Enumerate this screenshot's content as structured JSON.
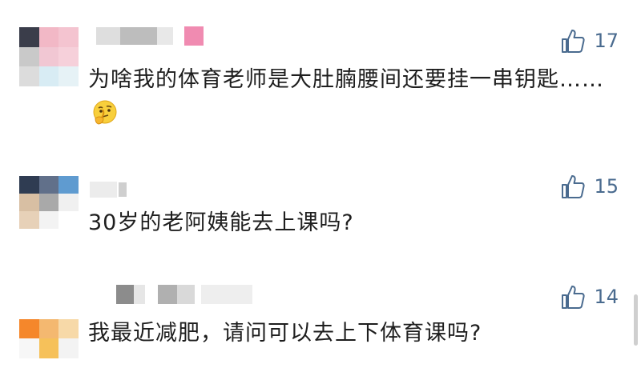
{
  "comments": [
    {
      "username": "",
      "text": "为啥我的体育老师是大肚腩腰间还要挂一串钥匙……",
      "likes": "17"
    },
    {
      "username": "",
      "text": "30岁的老阿姨能去上课吗?",
      "likes": "15"
    },
    {
      "username": "",
      "text": "我最近减肥，请问可以去上下体育课吗?",
      "likes": "14"
    }
  ],
  "icons": {
    "like": "thumbs-up-icon",
    "emoji": "thinking-face-emoji"
  },
  "colors": {
    "like_icon": "#4a6b8f",
    "text": "#1e1e1e",
    "background": "#ffffff"
  }
}
